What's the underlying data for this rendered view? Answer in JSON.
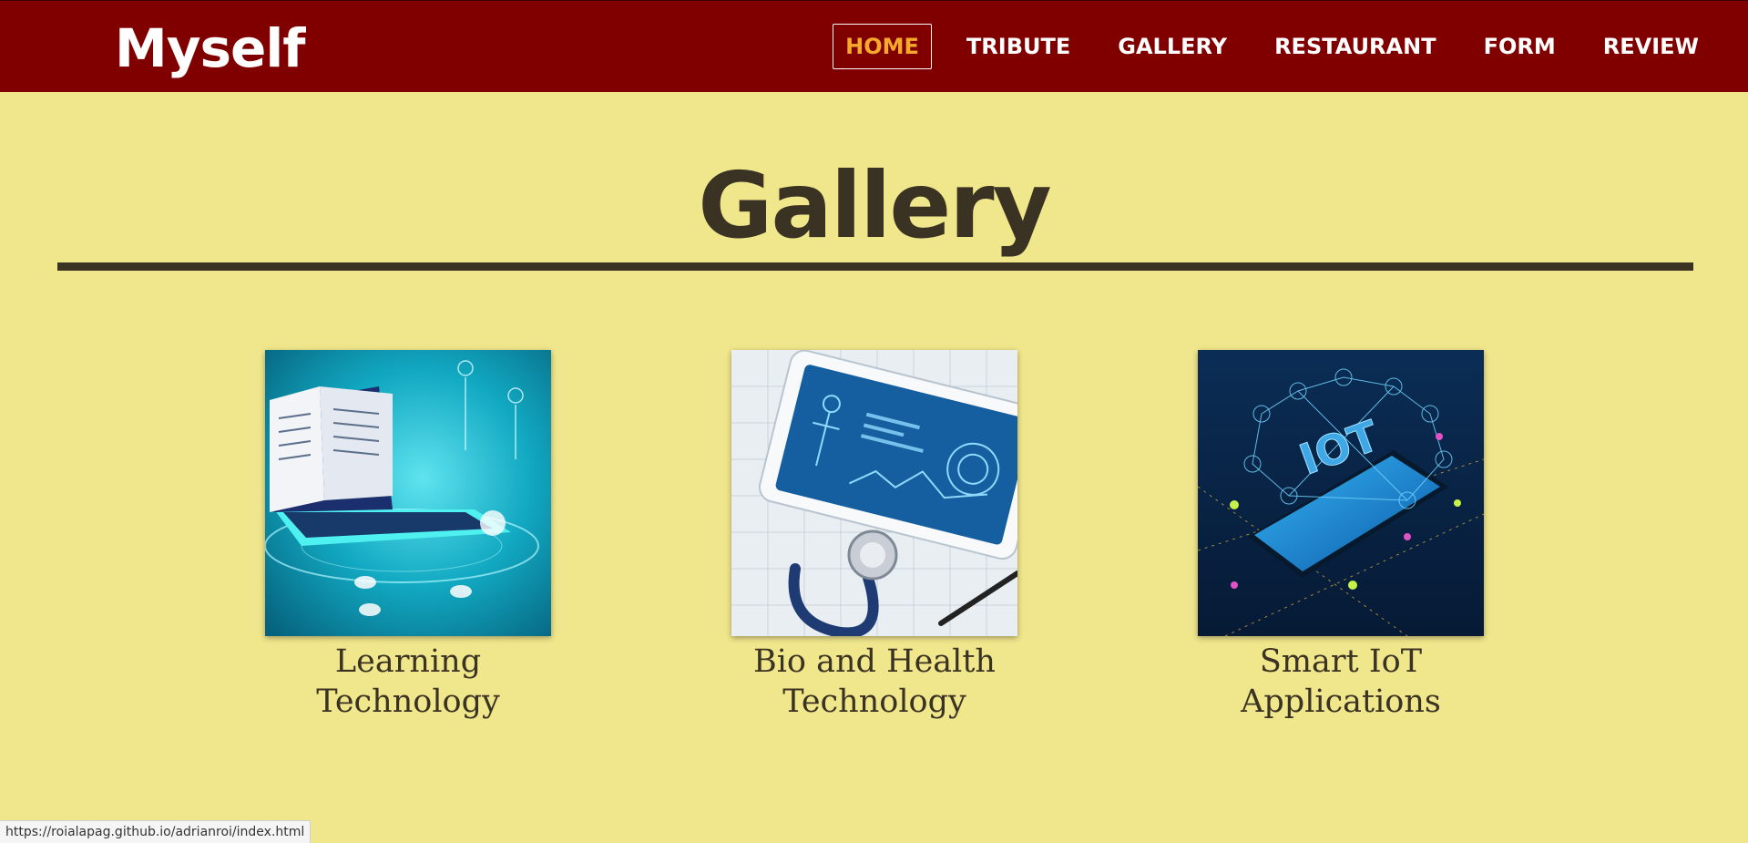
{
  "brand": "Myself",
  "nav": {
    "items": [
      {
        "label": "HOME",
        "active": true
      },
      {
        "label": "TRIBUTE",
        "active": false
      },
      {
        "label": "GALLERY",
        "active": false
      },
      {
        "label": "RESTAURANT",
        "active": false
      },
      {
        "label": "FORM",
        "active": false
      },
      {
        "label": "REVIEW",
        "active": false
      }
    ]
  },
  "page": {
    "title": "Gallery"
  },
  "gallery": [
    {
      "caption_line1": "Learning",
      "caption_line2": "Technology",
      "image": "laptop-book-tech-image"
    },
    {
      "caption_line1": "Bio and Health",
      "caption_line2": "Technology",
      "image": "tablet-stethoscope-image"
    },
    {
      "caption_line1": "Smart IoT",
      "caption_line2": "Applications",
      "image": "iot-smartphone-image"
    }
  ],
  "status_url": "https://roialapag.github.io/adrianroi/index.html",
  "colors": {
    "navbar": "#800000",
    "background": "#f0e68c",
    "active_nav": "#f4a92a",
    "text_dark": "#3a3222"
  }
}
